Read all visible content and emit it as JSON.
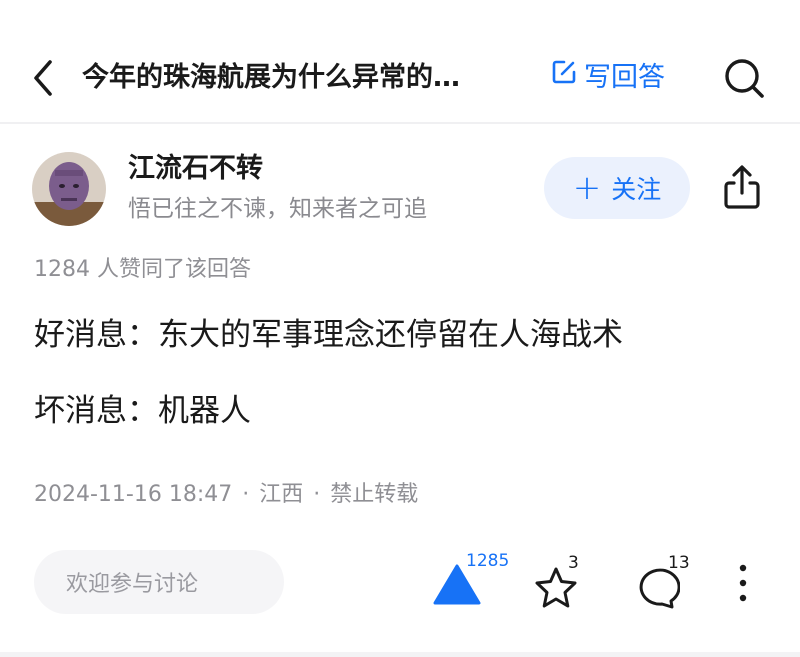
{
  "header": {
    "title": "今年的珠海航展为什么异常的…",
    "write_answer_label": "写回答"
  },
  "author": {
    "name": "江流石不转",
    "bio": "悟已往之不谏，知来者之可追",
    "follow_label": "关注"
  },
  "answer": {
    "likes_line": "1284 人赞同了该回答",
    "paragraphs": [
      "好消息：东大的军事理念还停留在人海战术",
      "坏消息：机器人"
    ],
    "meta": {
      "datetime": "2024-11-16 18:47",
      "separator": "·",
      "location": "江西",
      "copyright": "禁止转载"
    }
  },
  "bottom_bar": {
    "comment_placeholder": "欢迎参与讨论",
    "upvote_count": "1285",
    "favorite_count": "3",
    "comment_count": "13"
  },
  "colors": {
    "accent": "#1772f6",
    "follow_bg": "#ebf1fd",
    "muted_text": "#8f8f94"
  }
}
